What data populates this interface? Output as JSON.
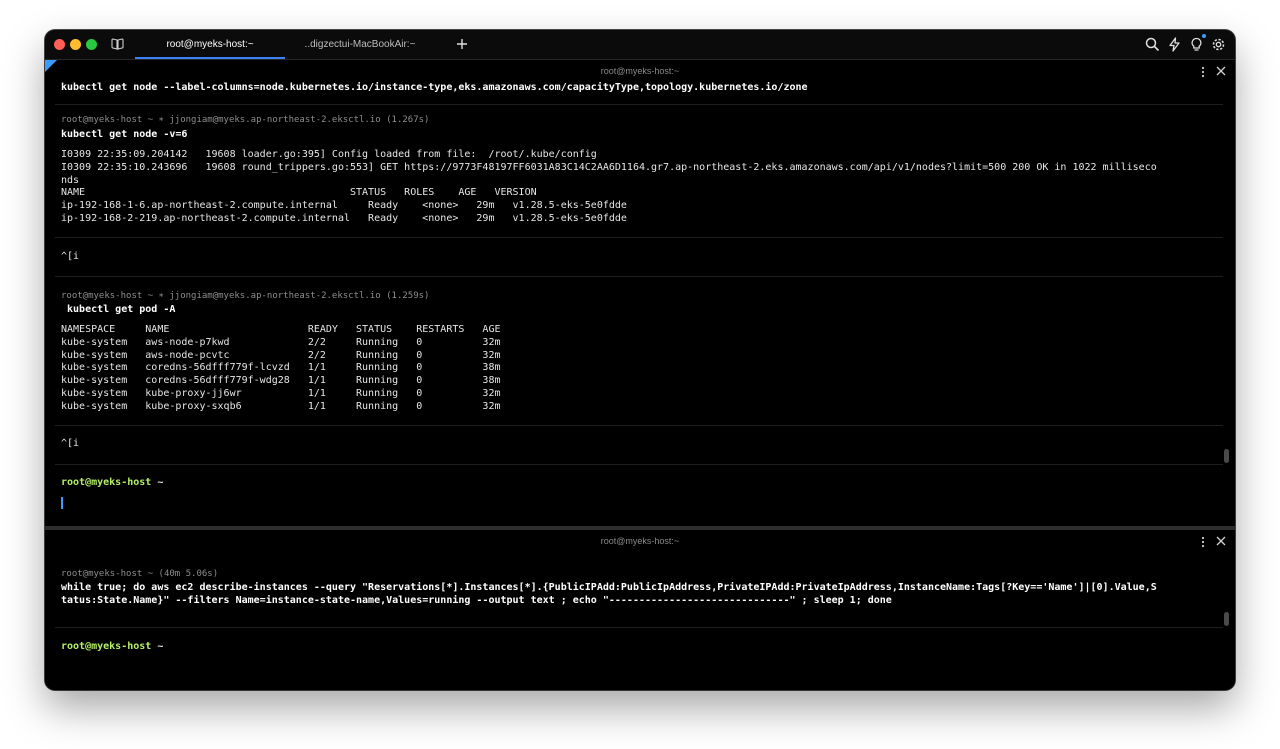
{
  "tabs": [
    {
      "label": "root@myeks-host:~",
      "active": true
    },
    {
      "label": "..digzectui-MacBookAir:~",
      "active": false
    }
  ],
  "icons": {
    "sidebar": "sidebar-icon",
    "new_tab": "plus-icon",
    "search": "search-icon",
    "bolt": "bolt-icon",
    "bulb": "lightbulb-icon",
    "settings": "gear-icon",
    "menu": "kebab-menu-icon",
    "close": "close-icon"
  },
  "colors": {
    "accent": "#3b9cff",
    "prompt": "#b5f066",
    "background": "#000000",
    "text": "#e6e6e6"
  },
  "top_pane": {
    "title": "root@myeks-host:~",
    "first_command": "kubectl get node --label-columns=node.kubernetes.io/instance-type,eks.amazonaws.com/capacityType,topology.kubernetes.io/zone",
    "block1": {
      "meta": "root@myeks-host ~ ∗ jjongiam@myeks.ap-northeast-2.eksctl.io (1.267s)",
      "command": "kubectl get node -v=6",
      "log1": "I0309 22:35:09.204142   19608 loader.go:395] Config loaded from file:  /root/.kube/config",
      "log2": "I0309 22:35:10.243696   19608 round_trippers.go:553] GET https://9773F48197FF6031A83C14C2AA6D1164.gr7.ap-northeast-2.eks.amazonaws.com/api/v1/nodes?limit=500 200 OK in 1022 milliseco",
      "log3": "nds",
      "header": "NAME                                            STATUS   ROLES    AGE   VERSION",
      "rows": [
        "ip-192-168-1-6.ap-northeast-2.compute.internal     Ready    <none>   29m   v1.28.5-eks-5e0fdde",
        "ip-192-168-2-219.ap-northeast-2.compute.internal   Ready    <none>   29m   v1.28.5-eks-5e0fdde"
      ]
    },
    "esc1": "^[i",
    "block2": {
      "meta": "root@myeks-host ~ ∗ jjongiam@myeks.ap-northeast-2.eksctl.io (1.259s)",
      "command": " kubectl get pod -A",
      "header": "NAMESPACE     NAME                       READY   STATUS    RESTARTS   AGE",
      "rows": [
        "kube-system   aws-node-p7kwd             2/2     Running   0          32m",
        "kube-system   aws-node-pcvtc             2/2     Running   0          32m",
        "kube-system   coredns-56dfff779f-lcvzd   1/1     Running   0          38m",
        "kube-system   coredns-56dfff779f-wdg28   1/1     Running   0          38m",
        "kube-system   kube-proxy-jj6wr           1/1     Running   0          32m",
        "kube-system   kube-proxy-sxqb6           1/1     Running   0          32m"
      ]
    },
    "esc2": "^[i",
    "prompt_user": "root@myeks-host",
    "prompt_dir": "~"
  },
  "bottom_pane": {
    "title": "root@myeks-host:~",
    "meta": "root@myeks-host ~ (40m 5.06s)",
    "command_line1": "while true; do aws ec2 describe-instances --query \"Reservations[*].Instances[*].{PublicIPAdd:PublicIpAddress,PrivateIPAdd:PrivateIpAddress,InstanceName:Tags[?Key=='Name']|[0].Value,S",
    "command_line2": "tatus:State.Name}\" --filters Name=instance-state-name,Values=running --output text ; echo \"------------------------------\" ; sleep 1; done",
    "prompt_user": "root@myeks-host",
    "prompt_dir": "~"
  }
}
